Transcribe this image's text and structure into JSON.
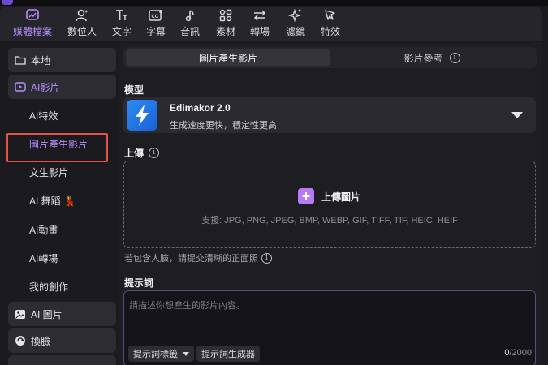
{
  "toolbar": {
    "items": [
      {
        "label": "媒體檔案",
        "icon": "media-icon"
      },
      {
        "label": "數位人",
        "icon": "avatar-icon"
      },
      {
        "label": "文字",
        "icon": "text-icon"
      },
      {
        "label": "字幕",
        "icon": "subtitle-icon"
      },
      {
        "label": "音訊",
        "icon": "music-icon"
      },
      {
        "label": "素材",
        "icon": "elements-icon"
      },
      {
        "label": "轉場",
        "icon": "transition-icon"
      },
      {
        "label": "濾鏡",
        "icon": "filter-icon"
      },
      {
        "label": "特效",
        "icon": "effects-icon"
      }
    ],
    "active_index": 0
  },
  "sidebar": {
    "local": "本地",
    "ai_video": "AI影片",
    "sub_items": [
      "AI特效",
      "圖片產生影片",
      "文生影片",
      "AI 舞蹈 💃",
      "AI動畫",
      "AI轉場",
      "我的創作"
    ],
    "selected_sub": "圖片產生影片",
    "ai_image": "AI 圖片",
    "face_swap": "換臉"
  },
  "tabs": {
    "image_to_video": "圖片產生影片",
    "video_reference": "影片參考"
  },
  "model": {
    "section_label": "模型",
    "name": "Edimakor 2.0",
    "description": "生成速度更快，穩定性更高"
  },
  "upload": {
    "section_label": "上傳",
    "button_label": "上傳圖片",
    "formats": "支援: JPG, PNG, JPEG, BMP, WEBP, GIF, TIFF, TIF, HEIC, HEIF",
    "face_hint": "若包含人臉，請提交清晰的正面照"
  },
  "prompt": {
    "section_label": "提示詞",
    "placeholder": "請描述你想產生的影片內容。",
    "tags_button": "提示詞標籤",
    "generator_button": "提示詞生成器",
    "count_current": "0",
    "count_max": "/2000"
  },
  "colors": {
    "accent": "#b690ff",
    "highlight_box": "#e2544a",
    "background": "#1b1a1f"
  }
}
